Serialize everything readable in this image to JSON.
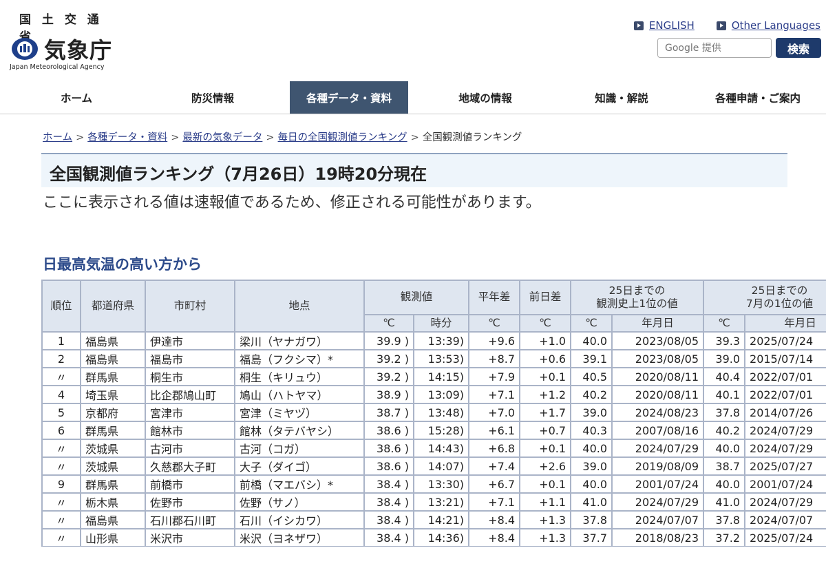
{
  "header": {
    "ministry": "国 土 交 通 省",
    "agency_jp": "気象庁",
    "agency_en": "Japan Meteorological Agency",
    "english_label": "ENGLISH",
    "other_languages_label": "Other Languages",
    "search_placeholder": "Google 提供",
    "search_button": "検索"
  },
  "nav": {
    "items": [
      "ホーム",
      "防災情報",
      "各種データ・資料",
      "地域の情報",
      "知識・解説",
      "各種申請・ご案内"
    ],
    "active_index": 2
  },
  "breadcrumb": [
    "ホーム",
    "各種データ・資料",
    "最新の気象データ",
    "毎日の全国観測値ランキング",
    "全国観測値ランキング"
  ],
  "title": "全国観測値ランキング（7月26日）19時20分現在",
  "notice": "ここに表示される値は速報値であるため、修正される可能性があります。",
  "section_heading": "日最高気温の高い方から",
  "table": {
    "headers": {
      "rank": "順位",
      "prefecture": "都道府県",
      "city": "市町村",
      "station": "地点",
      "observed": "観測値",
      "normal_diff": "平年差",
      "prev_diff": "前日差",
      "record_all_1": "25日までの",
      "record_all_2": "観測史上1位の値",
      "record_july_1": "25日までの",
      "record_july_2": "7月の1位の値",
      "unit_c": "℃",
      "time": "時分",
      "date": "年月日"
    },
    "rows": [
      {
        "rank": "1",
        "pref": "福島県",
        "city": "伊達市",
        "station": "梁川（ヤナガワ）",
        "value": "39.9 )",
        "time": "13:39)",
        "normal": "+9.6",
        "prev": "+1.0",
        "rec_all": "40.0",
        "rec_all_date": "2023/08/05",
        "rec_jul": "39.3",
        "rec_jul_date": "2025/07/24"
      },
      {
        "rank": "2",
        "pref": "福島県",
        "city": "福島市",
        "station": "福島（フクシマ）*",
        "value": "39.2 )",
        "time": "13:53)",
        "normal": "+8.7",
        "prev": "+0.6",
        "rec_all": "39.1",
        "rec_all_date": "2023/08/05",
        "rec_jul": "39.0",
        "rec_jul_date": "2015/07/14"
      },
      {
        "rank": "〃",
        "pref": "群馬県",
        "city": "桐生市",
        "station": "桐生（キリュウ）",
        "value": "39.2 )",
        "time": "14:15)",
        "normal": "+7.9",
        "prev": "+0.1",
        "rec_all": "40.5",
        "rec_all_date": "2020/08/11",
        "rec_jul": "40.4",
        "rec_jul_date": "2022/07/01"
      },
      {
        "rank": "4",
        "pref": "埼玉県",
        "city": "比企郡鳩山町",
        "station": "鳩山（ハトヤマ）",
        "value": "38.9 )",
        "time": "13:09)",
        "normal": "+7.1",
        "prev": "+1.2",
        "rec_all": "40.2",
        "rec_all_date": "2020/08/11",
        "rec_jul": "40.1",
        "rec_jul_date": "2022/07/01"
      },
      {
        "rank": "5",
        "pref": "京都府",
        "city": "宮津市",
        "station": "宮津（ミヤヅ）",
        "value": "38.7 )",
        "time": "13:48)",
        "normal": "+7.0",
        "prev": "+1.7",
        "rec_all": "39.0",
        "rec_all_date": "2024/08/23",
        "rec_jul": "37.8",
        "rec_jul_date": "2014/07/26"
      },
      {
        "rank": "6",
        "pref": "群馬県",
        "city": "館林市",
        "station": "館林（タテバヤシ）",
        "value": "38.6 )",
        "time": "15:28)",
        "normal": "+6.1",
        "prev": "+0.7",
        "rec_all": "40.3",
        "rec_all_date": "2007/08/16",
        "rec_jul": "40.2",
        "rec_jul_date": "2024/07/29"
      },
      {
        "rank": "〃",
        "pref": "茨城県",
        "city": "古河市",
        "station": "古河（コガ）",
        "value": "38.6 )",
        "time": "14:43)",
        "normal": "+6.8",
        "prev": "+0.1",
        "rec_all": "40.0",
        "rec_all_date": "2024/07/29",
        "rec_jul": "40.0",
        "rec_jul_date": "2024/07/29"
      },
      {
        "rank": "〃",
        "pref": "茨城県",
        "city": "久慈郡大子町",
        "station": "大子（ダイゴ）",
        "value": "38.6 )",
        "time": "14:07)",
        "normal": "+7.4",
        "prev": "+2.6",
        "rec_all": "39.0",
        "rec_all_date": "2019/08/09",
        "rec_jul": "38.7",
        "rec_jul_date": "2025/07/27"
      },
      {
        "rank": "9",
        "pref": "群馬県",
        "city": "前橋市",
        "station": "前橋（マエバシ）*",
        "value": "38.4 )",
        "time": "13:30)",
        "normal": "+6.7",
        "prev": "+0.1",
        "rec_all": "40.0",
        "rec_all_date": "2001/07/24",
        "rec_jul": "40.0",
        "rec_jul_date": "2001/07/24"
      },
      {
        "rank": "〃",
        "pref": "栃木県",
        "city": "佐野市",
        "station": "佐野（サノ）",
        "value": "38.4 )",
        "time": "13:21)",
        "normal": "+7.1",
        "prev": "+1.1",
        "rec_all": "41.0",
        "rec_all_date": "2024/07/29",
        "rec_jul": "41.0",
        "rec_jul_date": "2024/07/29"
      },
      {
        "rank": "〃",
        "pref": "福島県",
        "city": "石川郡石川町",
        "station": "石川（イシカワ）",
        "value": "38.4 )",
        "time": "14:21)",
        "normal": "+8.4",
        "prev": "+1.3",
        "rec_all": "37.8",
        "rec_all_date": "2024/07/07",
        "rec_jul": "37.8",
        "rec_jul_date": "2024/07/07"
      },
      {
        "rank": "〃",
        "pref": "山形県",
        "city": "米沢市",
        "station": "米沢（ヨネザワ）",
        "value": "38.4 )",
        "time": "14:36)",
        "normal": "+8.4",
        "prev": "+1.3",
        "rec_all": "37.7",
        "rec_all_date": "2018/08/23",
        "rec_jul": "37.2",
        "rec_jul_date": "2025/07/24"
      }
    ]
  }
}
